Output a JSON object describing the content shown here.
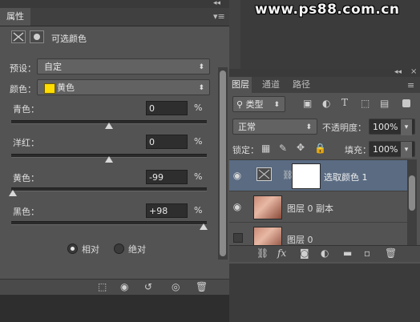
{
  "watermark": "www.ps88.com.cn",
  "properties": {
    "collapse": "◂◂",
    "menu": "▾≡",
    "tab": "属性",
    "header_title": "可选颜色",
    "preset_label": "预设：",
    "preset_value": "自定",
    "color_label": "颜色：",
    "color_value": "黄色",
    "color_swatch": "#ffdd00",
    "sliders": [
      {
        "label": "青色：",
        "value": "0",
        "unit": "%",
        "level": 0
      },
      {
        "label": "洋红：",
        "value": "0",
        "unit": "%",
        "level": 0
      },
      {
        "label": "黄色：",
        "value": "-99",
        "unit": "%",
        "level": -99
      },
      {
        "label": "黑色：",
        "value": "+98",
        "unit": "%",
        "level": 98
      }
    ],
    "radio_relative": "相对",
    "radio_absolute": "绝对",
    "radio_selected": "relative"
  },
  "layers": {
    "collapse": "◂◂",
    "close": "×",
    "tabs": [
      "图层",
      "通道",
      "路径"
    ],
    "active_tab": 0,
    "filter_label": "类型",
    "blend_mode": "正常",
    "opacity_label": "不透明度：",
    "opacity_value": "100%",
    "lock_label": "锁定：",
    "fill_label": "填充：",
    "fill_value": "100%",
    "rows": [
      {
        "name": "选取颜色 1",
        "visible": true,
        "selected": true,
        "type": "adjustment"
      },
      {
        "name": "图层 0 副本",
        "visible": true,
        "selected": false,
        "type": "image"
      },
      {
        "name": "图层 0",
        "visible": false,
        "selected": false,
        "type": "image"
      }
    ]
  },
  "colors": {
    "panel": "#535353",
    "selected_row": "#5a6b82",
    "accent_yellow": "#ffdd00"
  }
}
